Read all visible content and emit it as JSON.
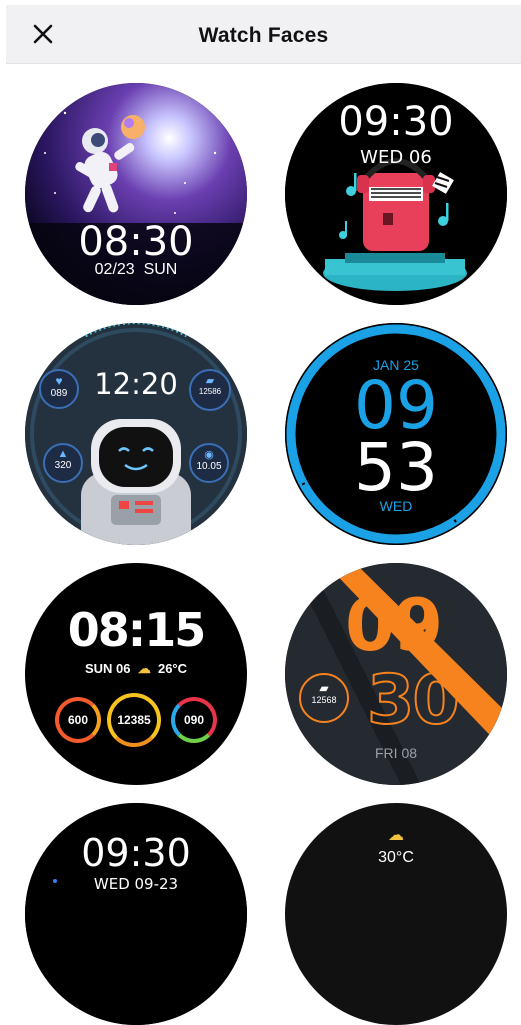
{
  "header": {
    "title": "Watch Faces",
    "close_icon": "close-icon"
  },
  "faces": [
    {
      "id": "astronaut-space",
      "time": "08:30",
      "date": "02/23",
      "day": "SUN"
    },
    {
      "id": "dj-headphones",
      "time": "09:30",
      "date": "WED 06"
    },
    {
      "id": "robot-astronaut",
      "time": "12:20",
      "heart": "089",
      "steps": "12586",
      "calories": "320",
      "distance": "10.05"
    },
    {
      "id": "blue-ring",
      "month_day": "JAN 25",
      "hour": "09",
      "minute": "53",
      "day": "WED"
    },
    {
      "id": "activity-rings",
      "time": "08:15",
      "date": "SUN 06",
      "temperature": "26°C",
      "calories": "600",
      "steps": "12385",
      "heart": "090"
    },
    {
      "id": "orange-stripe",
      "hour": "09",
      "minute": "30",
      "steps": "12568",
      "date": "FRI 08"
    },
    {
      "id": "partial-1",
      "time": "09:30",
      "date": "WED 09-23"
    },
    {
      "id": "partial-2",
      "temperature": "30°C"
    }
  ],
  "colors": {
    "header_bg": "#f1f1f4",
    "ring_blue": "#1ba1e6",
    "orange": "#f7831e"
  }
}
